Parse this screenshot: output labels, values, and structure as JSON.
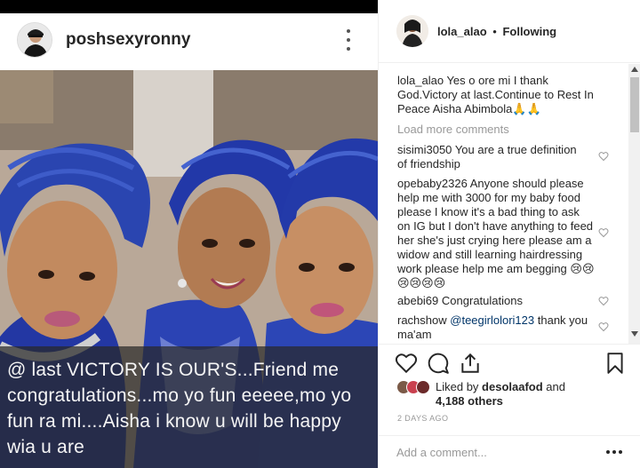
{
  "post": {
    "username": "poshsexyronny",
    "caption_overlay": "@ last VICTORY IS OUR'S...Friend me congratulations...mo yo fun eeeee,mo yo fun ra mi....Aisha i know u will be happy wia u are"
  },
  "detail": {
    "username": "lola_alao",
    "follow_separator": "•",
    "follow_status": "Following",
    "owner_comment": {
      "user": "lola_alao",
      "text": "Yes o ore mi I thank God.Victory at last.Continue to Rest In Peace Aisha Abimbola🙏🙏"
    },
    "load_more": "Load more comments",
    "comments": [
      {
        "user": "sisimi3050",
        "text": "You are a true definition of friendship"
      },
      {
        "user": "opebaby2326",
        "text": "Anyone should please help me with 3000 for my baby food please I know it's a bad thing to ask on IG but I don't have anything to feed her she's just crying here please am a widow and still learning hairdressing work please help me am begging 😢😢😢😢😢😢"
      },
      {
        "user": "abebi69",
        "text": "Congratulations"
      },
      {
        "user": "rachshow",
        "mention": "@teegirlolori123",
        "text": "thank you ma'am"
      }
    ],
    "likes": {
      "prefix": "Liked by",
      "liker": "desolaafod",
      "and": "and",
      "count": "4,188 others"
    },
    "timestamp": "2 DAYS AGO",
    "add_comment_placeholder": "Add a comment..."
  },
  "icons": {
    "like": "heart-icon",
    "comment": "comment-bubble-icon",
    "share": "share-icon",
    "save": "bookmark-icon",
    "more": "more-dots-icon"
  },
  "colors": {
    "text": "#262626",
    "muted": "#999999",
    "mention": "#003569",
    "border": "#efefef",
    "gele_blue": "#2e48a8"
  }
}
